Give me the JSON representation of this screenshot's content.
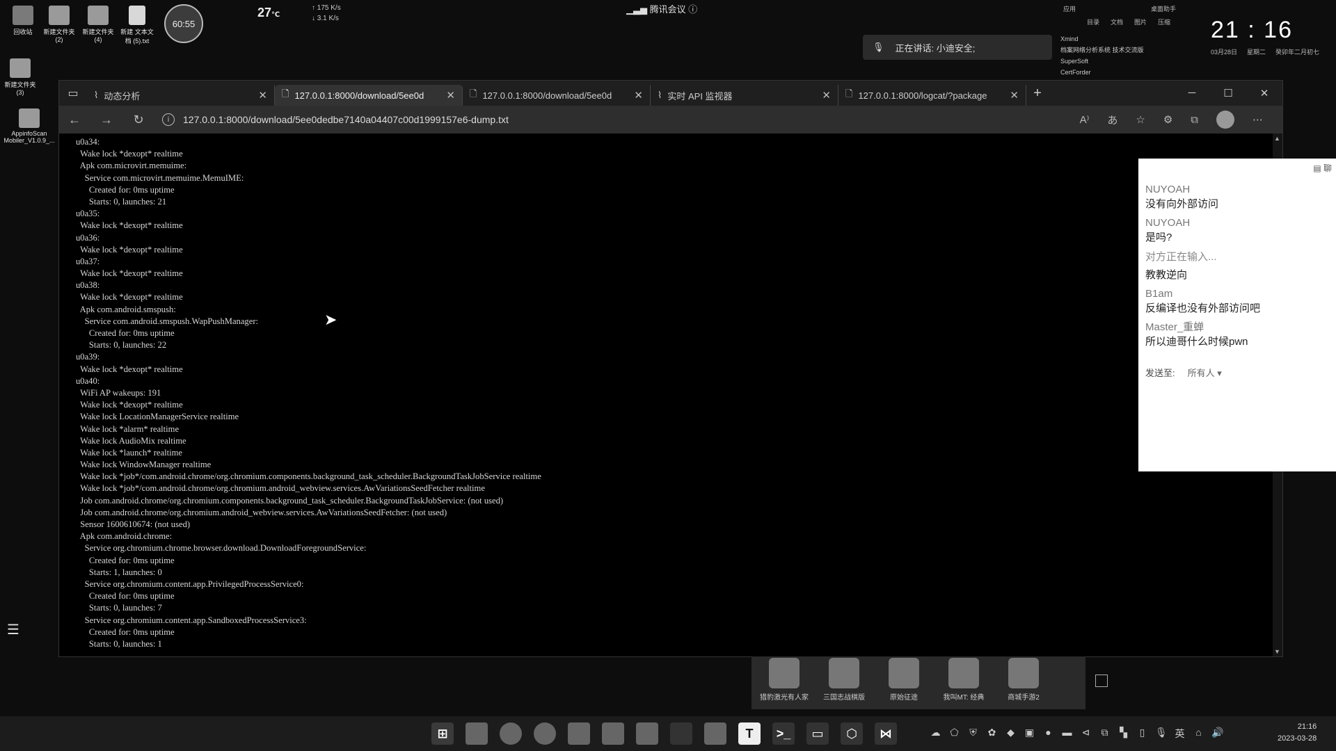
{
  "desktop": {
    "icons": [
      {
        "label": "回收站"
      },
      {
        "label": "新建文件夹 (2)"
      },
      {
        "label": "新建文件夹 (4)"
      },
      {
        "label": "新建 文本文档 (5).txt"
      },
      {
        "label": "新建文件夹 (3)"
      },
      {
        "label": "AppinfoScan Mobiler_V1.0.9_..."
      }
    ],
    "timer": "60:55",
    "weather_temp": "27",
    "weather_unit": "℃",
    "net_up": "175 K/s",
    "net_down": "3.1 K/s",
    "meeting_title": "腾讯会议",
    "speaking_text": "正在讲话: 小迪安全;",
    "top_menu_row1": [
      "应用",
      "",
      "",
      "",
      "桌面助手"
    ],
    "top_menu_row2": [
      "目录",
      "文档",
      "图片",
      "压缩"
    ],
    "side_apps": [
      "Xmind",
      "档案网络分析系统 技术交流版",
      "SuperSoft",
      "CertForder"
    ],
    "clock_time": "21 : 16",
    "clock_date": "03月28日",
    "clock_weekday": "星期二",
    "clock_lunar": "癸卯年二月初七"
  },
  "browser": {
    "tabs": [
      {
        "title": "动态分析",
        "active": false
      },
      {
        "title": "127.0.0.1:8000/download/5ee0d",
        "active": true
      },
      {
        "title": "127.0.0.1:8000/download/5ee0d",
        "active": false
      },
      {
        "title": "实时 API 监视器",
        "active": false
      },
      {
        "title": "127.0.0.1:8000/logcat/?package",
        "active": false
      }
    ],
    "url": "127.0.0.1:8000/download/5ee0dedbe7140a04407c00d1999157e6-dump.txt",
    "dump_lines": [
      "u0a34:",
      "  Wake lock *dexopt* realtime",
      "  Apk com.microvirt.memuime:",
      "    Service com.microvirt.memuime.MemuIME:",
      "      Created for: 0ms uptime",
      "      Starts: 0, launches: 21",
      "u0a35:",
      "  Wake lock *dexopt* realtime",
      "u0a36:",
      "  Wake lock *dexopt* realtime",
      "u0a37:",
      "  Wake lock *dexopt* realtime",
      "u0a38:",
      "  Wake lock *dexopt* realtime",
      "  Apk com.android.smspush:",
      "    Service com.android.smspush.WapPushManager:",
      "      Created for: 0ms uptime",
      "      Starts: 0, launches: 22",
      "u0a39:",
      "  Wake lock *dexopt* realtime",
      "u0a40:",
      "  WiFi AP wakeups: 191",
      "  Wake lock *dexopt* realtime",
      "  Wake lock LocationManagerService realtime",
      "  Wake lock *alarm* realtime",
      "  Wake lock AudioMix realtime",
      "  Wake lock *launch* realtime",
      "  Wake lock WindowManager realtime",
      "  Wake lock *job*/com.android.chrome/org.chromium.components.background_task_scheduler.BackgroundTaskJobService realtime",
      "  Wake lock *job*/com.android.chrome/org.chromium.android_webview.services.AwVariationsSeedFetcher realtime",
      "  Job com.android.chrome/org.chromium.components.background_task_scheduler.BackgroundTaskJobService: (not used)",
      "  Job com.android.chrome/org.chromium.android_webview.services.AwVariationsSeedFetcher: (not used)",
      "  Sensor 1600610674: (not used)",
      "  Apk com.android.chrome:",
      "    Service org.chromium.chrome.browser.download.DownloadForegroundService:",
      "      Created for: 0ms uptime",
      "      Starts: 1, launches: 0",
      "    Service org.chromium.content.app.PrivilegedProcessService0:",
      "      Created for: 0ms uptime",
      "      Starts: 0, launches: 7",
      "    Service org.chromium.content.app.SandboxedProcessService3:",
      "      Created for: 0ms uptime",
      "      Starts: 0, launches: 1"
    ]
  },
  "chat": {
    "header": "聊",
    "messages": [
      {
        "name": "NUYOAH",
        "text": "没有向外部访问"
      },
      {
        "name": "NUYOAH",
        "text": "是吗?"
      }
    ],
    "typing": "对方正在输入...",
    "messages2": [
      {
        "name": "",
        "text": "教教逆向"
      },
      {
        "name": "B1am",
        "text": "反编译也没有外部访问吧"
      },
      {
        "name": "Master_重蝉",
        "text": "所以迪哥什么时候pwn"
      }
    ],
    "send_label": "发送至:",
    "send_target": "所有人"
  },
  "gamebar": {
    "games": [
      "猎豹激光有人家",
      "三国志战棋版",
      "原始征途",
      "我叫MT: 经典",
      "商城手游2"
    ]
  },
  "taskbar": {
    "ime": "英",
    "time": "21:16",
    "date": "2023-03-28"
  }
}
